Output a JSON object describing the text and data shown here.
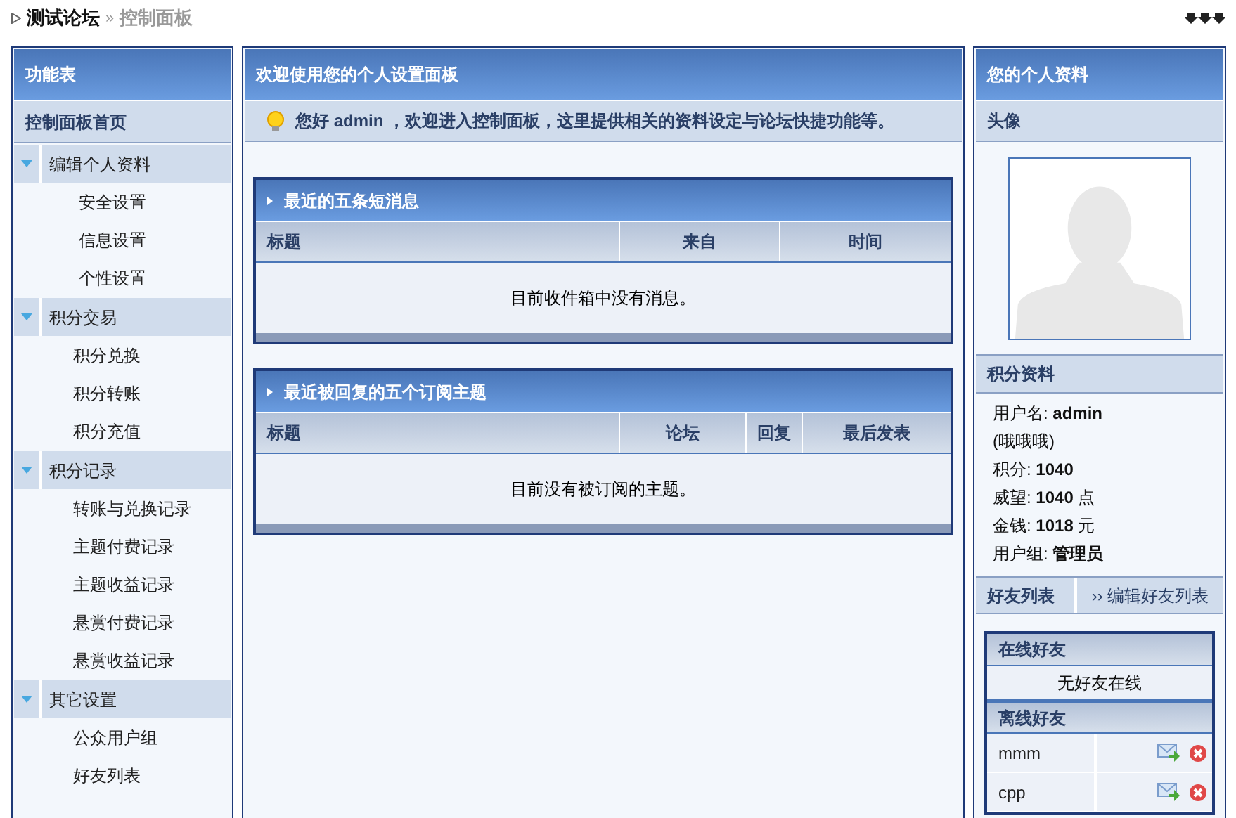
{
  "breadcrumb": {
    "items": [
      "测试论坛",
      "控制面板"
    ],
    "separator": "»"
  },
  "sidebar": {
    "title": "功能表",
    "home": "控制面板首页",
    "groups": [
      {
        "label": "编辑个人资料",
        "expanded": true,
        "items": [
          "安全设置",
          "信息设置",
          "个性设置"
        ]
      },
      {
        "label": "积分交易",
        "expanded": true,
        "items": [
          "积分兑换",
          "积分转账",
          "积分充值"
        ]
      },
      {
        "label": "积分记录",
        "expanded": true,
        "items": [
          "转账与兑换记录",
          "主题付费记录",
          "主题收益记录",
          "悬赏付费记录",
          "悬赏收益记录"
        ]
      },
      {
        "label": "其它设置",
        "expanded": true,
        "items": [
          "公众用户组",
          "好友列表"
        ]
      }
    ]
  },
  "main": {
    "title": "欢迎使用您的个人设置面板",
    "welcome": "您好 admin ，欢迎进入控制面板，这里提供相关的资料设定与论坛快捷功能等。",
    "sections": [
      {
        "title": "最近的五条短消息",
        "columns": [
          "标题",
          "来自",
          "时间"
        ],
        "empty": "目前收件箱中没有消息。"
      },
      {
        "title": "最近被回复的五个订阅主题",
        "columns": [
          "标题",
          "论坛",
          "回复",
          "最后发表"
        ],
        "empty": "目前没有被订阅的主题。"
      }
    ]
  },
  "profile": {
    "title": "您的个人资料",
    "avatar_heading": "头像",
    "credits_heading": "积分资料",
    "stats": [
      "用户名: **admin**",
      "(哦哦哦)",
      "积分: **1040**",
      "威望: **1040** 点",
      "金钱: **1018** 元",
      "用户组: **管理员**"
    ],
    "friends_heading": "好友列表",
    "edit_friends": "›› 编辑好友列表",
    "online_heading": "在线好友",
    "online_empty": "无好友在线",
    "offline_heading": "离线好友",
    "offline": [
      {
        "name": "mmm"
      },
      {
        "name": "cpp"
      }
    ]
  }
}
